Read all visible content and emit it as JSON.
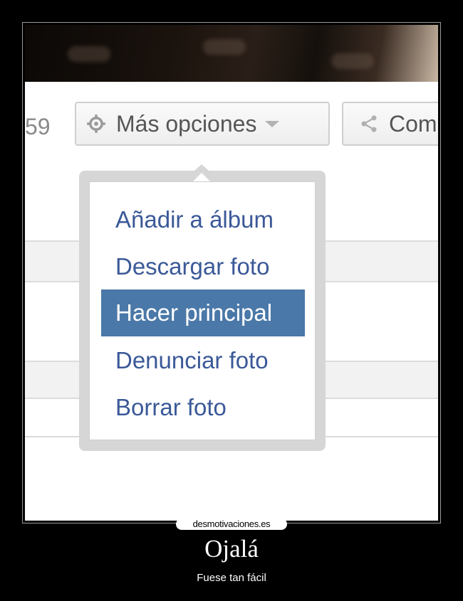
{
  "toolbar": {
    "count_text": "59",
    "more_options_label": "Más opciones",
    "share_label": "Com"
  },
  "menu": {
    "items": [
      {
        "label": "Añadir a álbum"
      },
      {
        "label": "Descargar foto"
      },
      {
        "label": "Hacer principal"
      },
      {
        "label": "Denunciar foto"
      },
      {
        "label": "Borrar foto"
      }
    ],
    "active_index": 2
  },
  "poster": {
    "site": "desmotivaciones.es",
    "title": "Ojalá",
    "subtitle": "Fuese tan fácil"
  },
  "colors": {
    "menu_link": "#3b5998",
    "menu_highlight": "#4a78a8",
    "poster_background": "#000000"
  },
  "icons": {
    "more_options": "gear-icon",
    "dropdown": "chevron-down-icon",
    "share": "share-icon"
  }
}
